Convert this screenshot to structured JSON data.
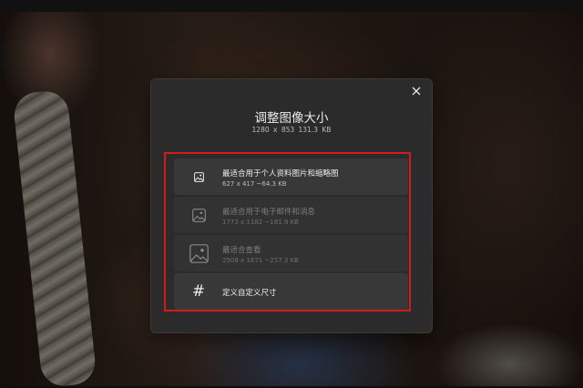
{
  "dialog": {
    "title": "调整图像大小",
    "original_size": "1280 x 853    131.3 KB",
    "close_icon": "close-icon"
  },
  "options": [
    {
      "label": "最适合用于个人资料图片和缩略图",
      "dimensions": "627 x 417    ~64.3 KB",
      "icon": "small-image-icon",
      "enabled": true
    },
    {
      "label": "最适合用于电子邮件和消息",
      "dimensions": "1773 x 1182    ~181.9 KB",
      "icon": "medium-image-icon",
      "enabled": false
    },
    {
      "label": "最适合查看",
      "dimensions": "2508 x 1671    ~257.3 KB",
      "icon": "large-image-icon",
      "enabled": false
    },
    {
      "label": "定义自定义尺寸",
      "icon": "hash-icon",
      "glyph": "#",
      "enabled": true
    }
  ],
  "colors": {
    "dialog_bg": "#2b2b2b",
    "option_bg": "#383838",
    "highlight_border": "#d41b1b"
  }
}
